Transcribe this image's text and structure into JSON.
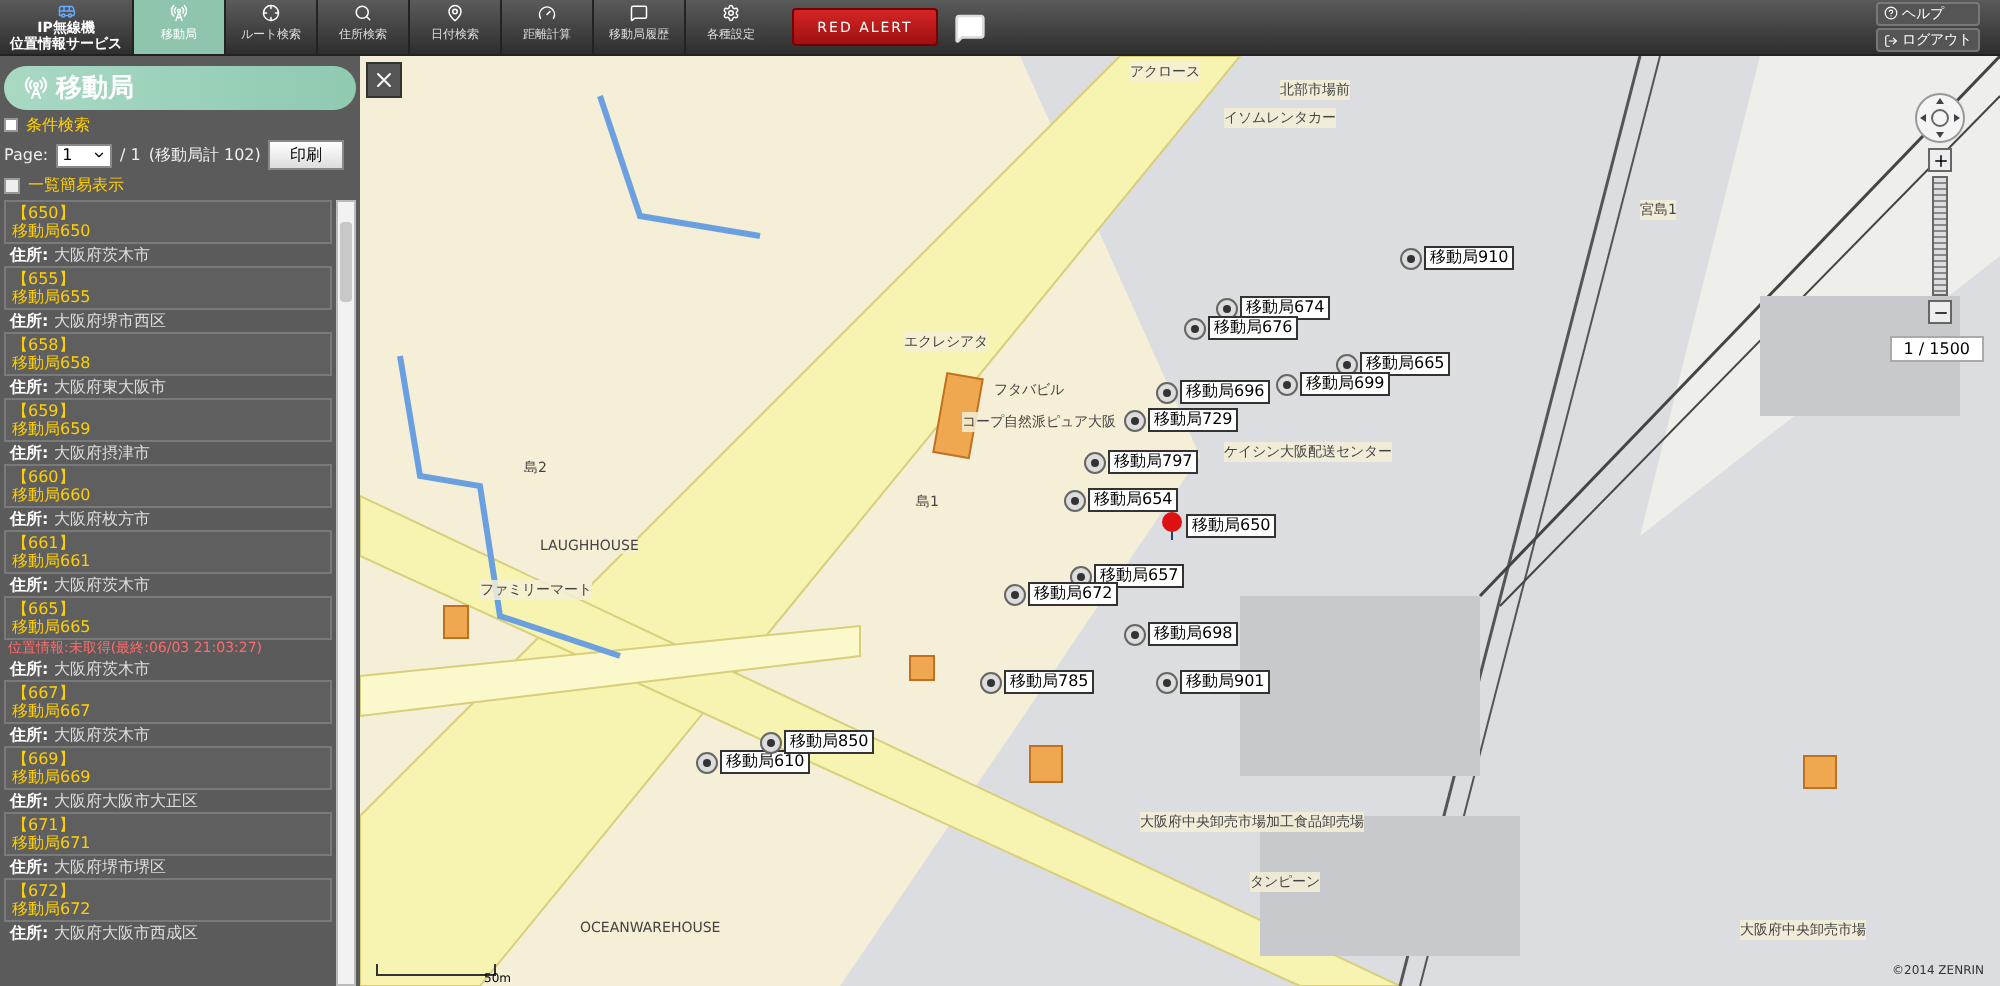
{
  "header": {
    "brand": [
      "IP無線機",
      "位置情報サービス"
    ],
    "tabs": [
      {
        "label": "移動局",
        "kind": "station",
        "selected": true
      },
      {
        "label": "ルート検索",
        "kind": "route",
        "selected": false
      },
      {
        "label": "住所検索",
        "kind": "search",
        "selected": false
      },
      {
        "label": "日付検索",
        "kind": "pin",
        "selected": false
      },
      {
        "label": "距離計算",
        "kind": "gauge",
        "selected": false
      },
      {
        "label": "移動局履歴",
        "kind": "history",
        "selected": false
      },
      {
        "label": "各種設定",
        "kind": "settings",
        "selected": false
      }
    ],
    "alert_button": "RED ALERT",
    "help_button": "ヘルプ",
    "logout_button": "ログアウト"
  },
  "sidebar": {
    "title": "移動局",
    "section": "条件検索",
    "page_label": "Page:",
    "page_value": "1",
    "page_total": "/ 1",
    "page_count": "(移動局計 102)",
    "print_button": "印刷",
    "simple_list": {
      "label": "一覧簡易表示",
      "checked": false
    },
    "stations": [
      {
        "id": "【650】",
        "name": "移動局650",
        "address_label": "住所:",
        "address": "大阪府茨木市"
      },
      {
        "id": "【655】",
        "name": "移動局655",
        "address_label": "住所:",
        "address": "大阪府堺市西区"
      },
      {
        "id": "【658】",
        "name": "移動局658",
        "address_label": "住所:",
        "address": "大阪府東大阪市"
      },
      {
        "id": "【659】",
        "name": "移動局659",
        "address_label": "住所:",
        "address": "大阪府摂津市"
      },
      {
        "id": "【660】",
        "name": "移動局660",
        "address_label": "住所:",
        "address": "大阪府枚方市"
      },
      {
        "id": "【661】",
        "name": "移動局661",
        "address_label": "住所:",
        "address": "大阪府茨木市"
      },
      {
        "id": "【665】",
        "name": "移動局665",
        "warning": "位置情報:未取得(最終:06/03 21:03:27)",
        "address_label": "住所:",
        "address": "大阪府茨木市"
      },
      {
        "id": "【667】",
        "name": "移動局667",
        "address_label": "住所:",
        "address": "大阪府茨木市"
      },
      {
        "id": "【669】",
        "name": "移動局669",
        "address_label": "住所:",
        "address": "大阪府大阪市大正区"
      },
      {
        "id": "【671】",
        "name": "移動局671",
        "address_label": "住所:",
        "address": "大阪府堺市堺区"
      },
      {
        "id": "【672】",
        "name": "移動局672",
        "address_label": "住所:",
        "address": "大阪府大阪市西成区"
      }
    ]
  },
  "map": {
    "scale": "1 / 1500",
    "scale_bar": "50m",
    "copyright": "©2014 ZENRIN",
    "places": [
      "北部市場前",
      "アクロース",
      "イソムレンタカー",
      "宮島1",
      "エクレシアタ",
      "フタバビル",
      "コープ自然派ピュア大阪",
      "島1",
      "島2",
      "ケイシン大阪配送センター",
      "LAUGHHOUSE",
      "ファミリーマート",
      "大阪府中央卸売市場加工食品卸売場",
      "タンピーン",
      "OCEANWAREHOUSE",
      "大阪府中央卸売市場"
    ],
    "markers": [
      {
        "label": "移動局910",
        "selected": false
      },
      {
        "label": "移動局674",
        "selected": false
      },
      {
        "label": "移動局676",
        "selected": false
      },
      {
        "label": "移動局665",
        "selected": false
      },
      {
        "label": "移動局699",
        "selected": false
      },
      {
        "label": "移動局696",
        "selected": false
      },
      {
        "label": "移動局729",
        "selected": false
      },
      {
        "label": "移動局797",
        "selected": false
      },
      {
        "label": "移動局654",
        "selected": false
      },
      {
        "label": "移動局650",
        "selected": true
      },
      {
        "label": "移動局657",
        "selected": false
      },
      {
        "label": "移動局672",
        "selected": false
      },
      {
        "label": "移動局698",
        "selected": false
      },
      {
        "label": "移動局785",
        "selected": false
      },
      {
        "label": "移動局901",
        "selected": false
      },
      {
        "label": "移動局610",
        "selected": false
      },
      {
        "label": "移動局850",
        "selected": false
      }
    ]
  }
}
